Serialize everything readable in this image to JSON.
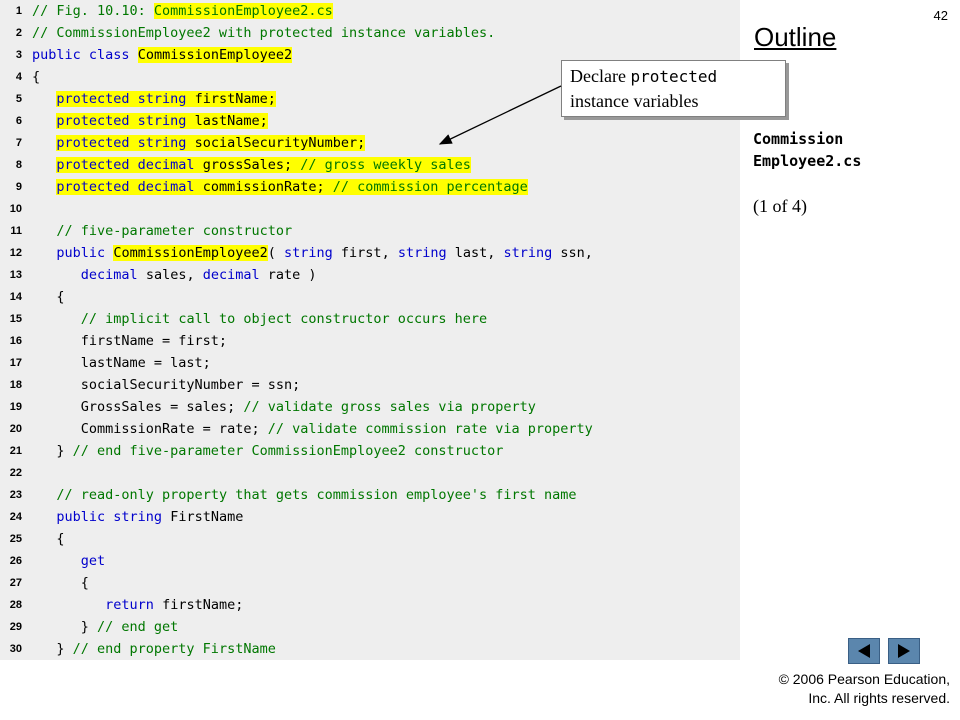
{
  "page_number": "42",
  "outline_title": "Outline",
  "callout": {
    "word1": "Declare",
    "code_word": "protected",
    "line2": "instance variables"
  },
  "file_name": {
    "line1": "Commission",
    "line2": "Employee2.cs"
  },
  "page_of": "(1 of 4)",
  "nav": {
    "prev_icon": "left-triangle-icon",
    "next_icon": "right-triangle-icon",
    "color": "#5b86ad"
  },
  "copyright": {
    "line1": "© 2006 Pearson Education,",
    "line2": "Inc.  All rights reserved."
  },
  "colors": {
    "keyword": "#0000cc",
    "comment": "#007700",
    "highlight": "#ffff00",
    "code_background": "#eeeeee"
  },
  "code_lines": [
    {
      "n": "1",
      "tokens": [
        {
          "t": "// Fig. 10.10: ",
          "c": "cm"
        },
        {
          "t": "CommissionEmployee2.cs",
          "c": "cm hl"
        }
      ]
    },
    {
      "n": "2",
      "tokens": [
        {
          "t": "// CommissionEmployee2 with protected instance variables.",
          "c": "cm"
        }
      ]
    },
    {
      "n": "3",
      "tokens": [
        {
          "t": "public class",
          "c": "kw"
        },
        {
          "t": " "
        },
        {
          "t": "CommissionEmployee2",
          "c": "hl"
        }
      ]
    },
    {
      "n": "4",
      "tokens": [
        {
          "t": "{"
        }
      ]
    },
    {
      "n": "5",
      "tokens": [
        {
          "t": "   "
        },
        {
          "t": "protected string",
          "c": "kw hl"
        },
        {
          "t": " firstName;",
          "c": "hl"
        }
      ]
    },
    {
      "n": "6",
      "tokens": [
        {
          "t": "   "
        },
        {
          "t": "protected string",
          "c": "kw hl"
        },
        {
          "t": " lastName;",
          "c": "hl"
        }
      ]
    },
    {
      "n": "7",
      "tokens": [
        {
          "t": "   "
        },
        {
          "t": "protected string",
          "c": "kw hl"
        },
        {
          "t": " socialSecurityNumber;",
          "c": "hl"
        }
      ]
    },
    {
      "n": "8",
      "tokens": [
        {
          "t": "   "
        },
        {
          "t": "protected decimal",
          "c": "kw hl"
        },
        {
          "t": " grossSales; ",
          "c": "hl"
        },
        {
          "t": "// gross weekly sales",
          "c": "cm hl"
        }
      ]
    },
    {
      "n": "9",
      "tokens": [
        {
          "t": "   "
        },
        {
          "t": "protected decimal",
          "c": "kw hl"
        },
        {
          "t": " commissionRate; ",
          "c": "hl"
        },
        {
          "t": "// commission percentage",
          "c": "cm hl"
        }
      ]
    },
    {
      "n": "10",
      "tokens": []
    },
    {
      "n": "11",
      "tokens": [
        {
          "t": "   "
        },
        {
          "t": "// five-parameter constructor",
          "c": "cm"
        }
      ]
    },
    {
      "n": "12",
      "tokens": [
        {
          "t": "   "
        },
        {
          "t": "public",
          "c": "kw"
        },
        {
          "t": " "
        },
        {
          "t": "CommissionEmployee2",
          "c": "hl"
        },
        {
          "t": "( "
        },
        {
          "t": "string",
          "c": "kw"
        },
        {
          "t": " first, "
        },
        {
          "t": "string",
          "c": "kw"
        },
        {
          "t": " last, "
        },
        {
          "t": "string",
          "c": "kw"
        },
        {
          "t": " ssn,"
        }
      ]
    },
    {
      "n": "13",
      "tokens": [
        {
          "t": "      "
        },
        {
          "t": "decimal",
          "c": "kw"
        },
        {
          "t": " sales, "
        },
        {
          "t": "decimal",
          "c": "kw"
        },
        {
          "t": " rate )"
        }
      ]
    },
    {
      "n": "14",
      "tokens": [
        {
          "t": "   {"
        }
      ]
    },
    {
      "n": "15",
      "tokens": [
        {
          "t": "      "
        },
        {
          "t": "// implicit call to object constructor occurs here",
          "c": "cm"
        }
      ]
    },
    {
      "n": "16",
      "tokens": [
        {
          "t": "      firstName = first;"
        }
      ]
    },
    {
      "n": "17",
      "tokens": [
        {
          "t": "      lastName = last;"
        }
      ]
    },
    {
      "n": "18",
      "tokens": [
        {
          "t": "      socialSecurityNumber = ssn;"
        }
      ]
    },
    {
      "n": "19",
      "tokens": [
        {
          "t": "      GrossSales = sales; "
        },
        {
          "t": "// validate gross sales via property",
          "c": "cm"
        }
      ]
    },
    {
      "n": "20",
      "tokens": [
        {
          "t": "      CommissionRate = rate; "
        },
        {
          "t": "// validate commission rate via property",
          "c": "cm"
        }
      ]
    },
    {
      "n": "21",
      "tokens": [
        {
          "t": "   } "
        },
        {
          "t": "// end five-parameter CommissionEmployee2 constructor",
          "c": "cm"
        }
      ]
    },
    {
      "n": "22",
      "tokens": []
    },
    {
      "n": "23",
      "tokens": [
        {
          "t": "   "
        },
        {
          "t": "// read-only property that gets commission employee's first name",
          "c": "cm"
        }
      ]
    },
    {
      "n": "24",
      "tokens": [
        {
          "t": "   "
        },
        {
          "t": "public string",
          "c": "kw"
        },
        {
          "t": " FirstName"
        }
      ]
    },
    {
      "n": "25",
      "tokens": [
        {
          "t": "   {"
        }
      ]
    },
    {
      "n": "26",
      "tokens": [
        {
          "t": "      "
        },
        {
          "t": "get",
          "c": "kw"
        }
      ]
    },
    {
      "n": "27",
      "tokens": [
        {
          "t": "      {"
        }
      ]
    },
    {
      "n": "28",
      "tokens": [
        {
          "t": "         "
        },
        {
          "t": "return",
          "c": "kw"
        },
        {
          "t": " firstName;"
        }
      ]
    },
    {
      "n": "29",
      "tokens": [
        {
          "t": "      } "
        },
        {
          "t": "// end get",
          "c": "cm"
        }
      ]
    },
    {
      "n": "30",
      "tokens": [
        {
          "t": "   } "
        },
        {
          "t": "// end property FirstName",
          "c": "cm"
        }
      ]
    }
  ]
}
